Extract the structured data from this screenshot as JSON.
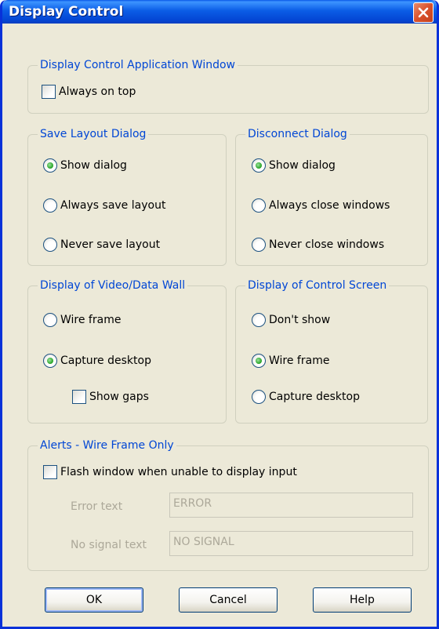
{
  "window": {
    "title": "Display Control"
  },
  "app_window_group": {
    "legend": "Display Control Application Window",
    "always_on_top": {
      "label": "Always on top",
      "checked": false
    }
  },
  "save_layout_group": {
    "legend": "Save Layout Dialog",
    "options": [
      "Show dialog",
      "Always save layout",
      "Never save layout"
    ],
    "selected": "Show dialog"
  },
  "disconnect_group": {
    "legend": "Disconnect Dialog",
    "options": [
      "Show dialog",
      "Always close windows",
      "Never close windows"
    ],
    "selected": "Show dialog"
  },
  "video_wall_group": {
    "legend": "Display of Video/Data Wall",
    "options": [
      "Wire frame",
      "Capture desktop"
    ],
    "selected": "Capture desktop",
    "show_gaps": {
      "label": "Show gaps",
      "checked": false
    }
  },
  "control_screen_group": {
    "legend": "Display of Control Screen",
    "options": [
      "Don't show",
      "Wire frame",
      "Capture desktop"
    ],
    "selected": "Wire frame"
  },
  "alerts_group": {
    "legend": "Alerts - Wire Frame Only",
    "flash_window": {
      "label": "Flash window when unable to display input",
      "checked": false
    },
    "error_text": {
      "label": "Error text",
      "value": "ERROR"
    },
    "no_signal_text": {
      "label": "No signal text",
      "value": "NO SIGNAL"
    }
  },
  "buttons": {
    "ok": "OK",
    "cancel": "Cancel",
    "help": "Help"
  }
}
